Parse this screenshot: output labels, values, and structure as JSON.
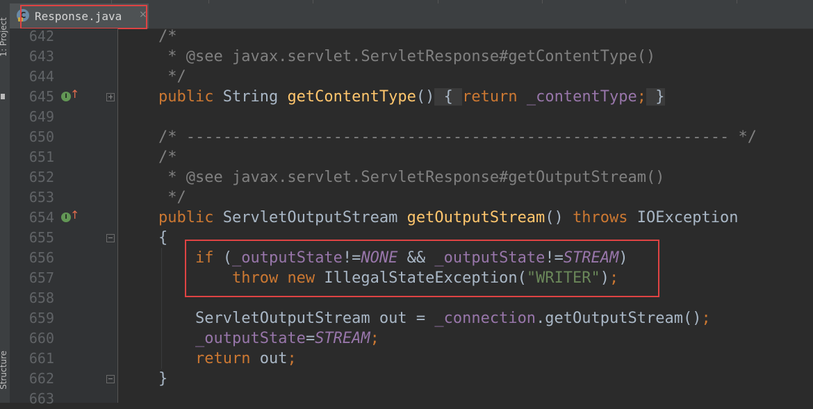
{
  "editor": {
    "tab": {
      "label": "Response.java",
      "icon": "class-file-icon",
      "close": "×"
    },
    "left_panels": [
      "1: Project",
      "Structure"
    ],
    "lines": [
      {
        "num": "642",
        "parts": [
          [
            "comment",
            "/*"
          ]
        ]
      },
      {
        "num": "643",
        "parts": [
          [
            "comment",
            " * @see javax.servlet.ServletResponse#getContentType()"
          ]
        ]
      },
      {
        "num": "644",
        "parts": [
          [
            "comment",
            " */"
          ]
        ]
      },
      {
        "num": "645",
        "parts": [
          [
            "kw",
            "public "
          ],
          [
            "type",
            "String "
          ],
          [
            "method",
            "getContentType"
          ],
          [
            "type",
            "()"
          ],
          [
            "fold",
            " { "
          ],
          [
            "kw",
            "return "
          ],
          [
            "field",
            "_contentType"
          ],
          [
            "kw",
            ";"
          ],
          [
            "fold",
            " }"
          ]
        ]
      },
      {
        "num": "649",
        "parts": []
      },
      {
        "num": "650",
        "parts": [
          [
            "comment",
            "/* ----------------------------------------------------------- */"
          ]
        ]
      },
      {
        "num": "651",
        "parts": [
          [
            "comment",
            "/*"
          ]
        ]
      },
      {
        "num": "652",
        "parts": [
          [
            "comment",
            " * @see javax.servlet.ServletResponse#getOutputStream()"
          ]
        ]
      },
      {
        "num": "653",
        "parts": [
          [
            "comment",
            " */"
          ]
        ]
      },
      {
        "num": "654",
        "parts": [
          [
            "kw",
            "public "
          ],
          [
            "type",
            "ServletOutputStream "
          ],
          [
            "method",
            "getOutputStream"
          ],
          [
            "type",
            "() "
          ],
          [
            "kw",
            "throws "
          ],
          [
            "type",
            "IOException"
          ]
        ]
      },
      {
        "num": "655",
        "parts": [
          [
            "type",
            "{"
          ]
        ]
      },
      {
        "num": "656",
        "parts": [
          [
            "type",
            "    "
          ],
          [
            "kw",
            "if "
          ],
          [
            "type",
            "("
          ],
          [
            "field",
            "_outputState"
          ],
          [
            "type",
            "!="
          ],
          [
            "fieldi",
            "NONE"
          ],
          [
            "type",
            " && "
          ],
          [
            "field",
            "_outputState"
          ],
          [
            "type",
            "!="
          ],
          [
            "fieldi",
            "STREAM"
          ],
          [
            "type",
            ")"
          ]
        ]
      },
      {
        "num": "657",
        "parts": [
          [
            "type",
            "        "
          ],
          [
            "kw",
            "throw new "
          ],
          [
            "type",
            "IllegalStateException("
          ],
          [
            "str",
            "\"WRITER\""
          ],
          [
            "type",
            ")"
          ],
          [
            "kw",
            ";"
          ]
        ]
      },
      {
        "num": "658",
        "parts": []
      },
      {
        "num": "659",
        "parts": [
          [
            "type",
            "    ServletOutputStream out = "
          ],
          [
            "field",
            "_connection"
          ],
          [
            "type",
            ".getOutputStream()"
          ],
          [
            "kw",
            ";"
          ]
        ]
      },
      {
        "num": "660",
        "parts": [
          [
            "type",
            "    "
          ],
          [
            "field",
            "_outputState"
          ],
          [
            "type",
            "="
          ],
          [
            "fieldi",
            "STREAM"
          ],
          [
            "kw",
            ";"
          ]
        ]
      },
      {
        "num": "661",
        "parts": [
          [
            "type",
            "    "
          ],
          [
            "kw",
            "return "
          ],
          [
            "type",
            "out"
          ],
          [
            "kw",
            ";"
          ]
        ]
      },
      {
        "num": "662",
        "parts": [
          [
            "type",
            "}"
          ]
        ]
      },
      {
        "num": "663",
        "parts": []
      }
    ],
    "gutter_icons": {
      "645": "implements-icon",
      "654": "implements-icon"
    },
    "gutter_icon_letter": "I",
    "gutter_arrow": "↑",
    "folds": {
      "645": "plus",
      "655": "open",
      "662": "open"
    }
  }
}
